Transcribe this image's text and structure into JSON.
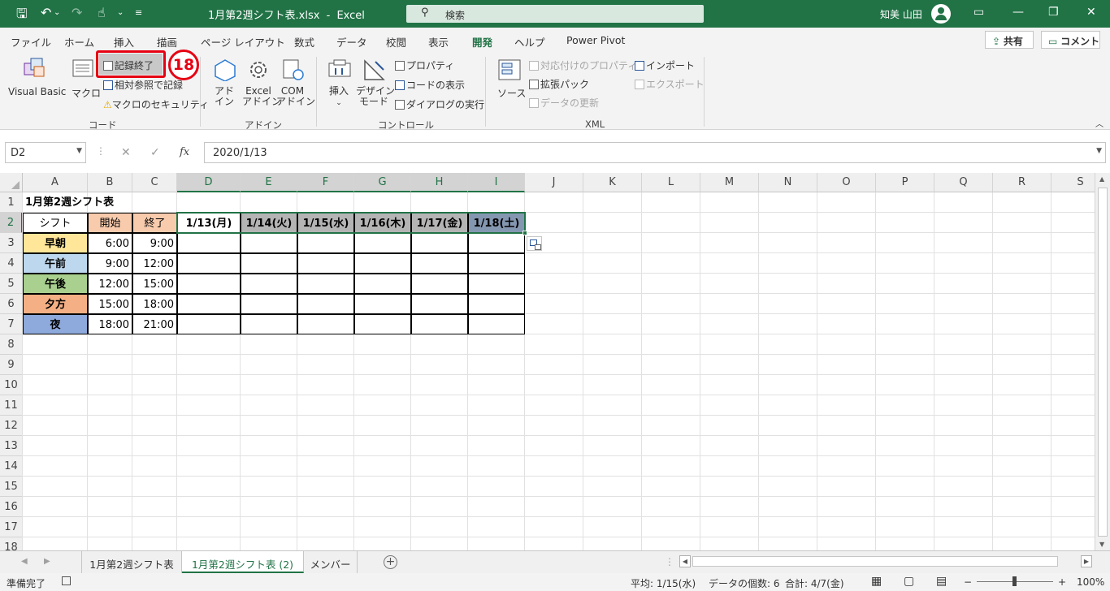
{
  "titlebar": {
    "filename": "1月第2週シフト表.xlsx",
    "app": "Excel",
    "separator": "-",
    "search_placeholder": "検索",
    "user": "知美 山田"
  },
  "tabs": [
    "ファイル",
    "ホーム",
    "挿入",
    "描画",
    "ページ レイアウト",
    "数式",
    "データ",
    "校閲",
    "表示",
    "開発",
    "ヘルプ",
    "Power Pivot"
  ],
  "active_tab": "開発",
  "share_label": "共有",
  "comment_label": "コメント",
  "ribbon": {
    "code": {
      "group": "コード",
      "visual_basic": "Visual Basic",
      "macro": "マクロ",
      "stop_recording": "記録終了",
      "relative_ref": "相対参照で記録",
      "macro_security": "マクロのセキュリティ"
    },
    "addins": {
      "group": "アドイン",
      "addin1": "アド",
      "addin2": "イン",
      "excel_addin1": "Excel",
      "excel_addin2": "アドイン",
      "com_addin1": "COM",
      "com_addin2": "アドイン"
    },
    "controls": {
      "group": "コントロール",
      "insert": "挿入",
      "design1": "デザイン",
      "design2": "モード",
      "properties": "プロパティ",
      "view_code": "コードの表示",
      "run_dialog": "ダイアログの実行"
    },
    "xml": {
      "group": "XML",
      "source": "ソース",
      "map_properties": "対応付けのプロパティ",
      "expansion_packs": "拡張パック",
      "refresh_data": "データの更新",
      "import": "インポート",
      "export": "エクスポート"
    }
  },
  "callout": "18",
  "formula": {
    "namebox": "D2",
    "value": "2020/1/13",
    "fx": "fx"
  },
  "columns": [
    "A",
    "B",
    "C",
    "D",
    "E",
    "F",
    "G",
    "H",
    "I",
    "J",
    "K",
    "L",
    "M",
    "N",
    "O",
    "P",
    "Q",
    "R",
    "S"
  ],
  "rows": [
    "1",
    "2",
    "3",
    "4",
    "5",
    "6",
    "7",
    "8",
    "9",
    "10",
    "11",
    "12",
    "13",
    "14",
    "15",
    "16",
    "17",
    "18"
  ],
  "sheet": {
    "title": "1月第2週シフト表",
    "headers": [
      "シフト",
      "開始",
      "終了"
    ],
    "dates": [
      "1/13(月)",
      "1/14(火)",
      "1/15(水)",
      "1/16(木)",
      "1/17(金)",
      "1/18(土)"
    ],
    "shifts": [
      {
        "name": "早朝",
        "start": "6:00",
        "end": "9:00",
        "color": "#ffe699"
      },
      {
        "name": "午前",
        "start": "9:00",
        "end": "12:00",
        "color": "#bdd7ee"
      },
      {
        "name": "午後",
        "start": "12:00",
        "end": "15:00",
        "color": "#a9d08e"
      },
      {
        "name": "夕方",
        "start": "15:00",
        "end": "18:00",
        "color": "#f4b084"
      },
      {
        "name": "夜",
        "start": "18:00",
        "end": "21:00",
        "color": "#8ea9db"
      }
    ]
  },
  "sheet_tabs": [
    "1月第2週シフト表",
    "1月第2週シフト表 (2)",
    "メンバー"
  ],
  "active_sheet": "1月第2週シフト表 (2)",
  "status": {
    "ready": "準備完了",
    "average": "平均: 1/15(水)",
    "count": "データの個数: 6",
    "sum": "合計: 4/7(金)",
    "zoom": "100%"
  },
  "colors": {
    "accent": "#217346",
    "header_pink": "#f8cbad",
    "callout_red": "#e60012"
  }
}
